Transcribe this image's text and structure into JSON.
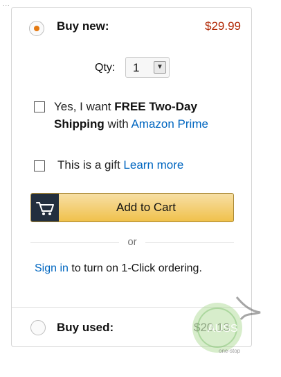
{
  "corner_mark": "...",
  "buy_new": {
    "label": "Buy new:",
    "price": "$29.99",
    "selected": true
  },
  "quantity": {
    "label": "Qty:",
    "value": "1"
  },
  "prime_option": {
    "text_prefix": "Yes, I want ",
    "text_bold": "FREE Two-Day Shipping",
    "text_middle": " with ",
    "link": "Amazon Prime",
    "checked": false
  },
  "gift_option": {
    "text": "This is a gift ",
    "link": "Learn more",
    "checked": false
  },
  "add_to_cart": {
    "label": "Add to Cart",
    "icon": "cart-icon"
  },
  "divider_text": "or",
  "one_click": {
    "link": "Sign in",
    "text": " to turn on 1-Click ordering."
  },
  "buy_used": {
    "label": "Buy used:",
    "price": "$20.13",
    "selected": false
  },
  "watermark": {
    "text": "AUSS",
    "subtext": "one-stop",
    "icon": "watermark-logo"
  },
  "colors": {
    "accent_orange": "#e47911",
    "price_red": "#b12704",
    "link_blue": "#0066c0",
    "button_gold": "#f0c14b",
    "cart_icon_bg": "#232f3e"
  }
}
